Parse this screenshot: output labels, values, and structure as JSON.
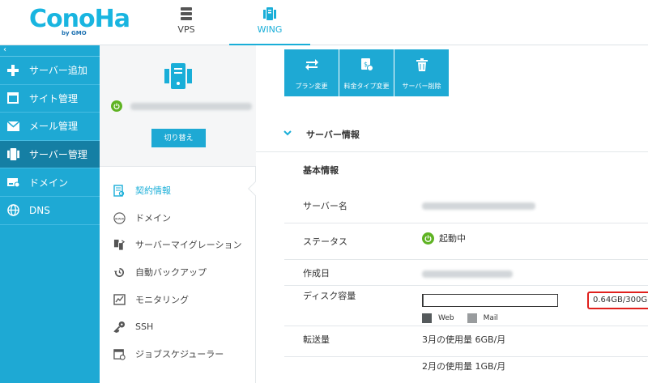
{
  "header": {
    "logo_main": "ConoHa",
    "logo_sub": "by GMO",
    "tabs": [
      {
        "label": "VPS",
        "icon": "server-stack-icon"
      },
      {
        "label": "WING",
        "icon": "wing-server-icon",
        "active": true
      }
    ]
  },
  "sidebar": {
    "collapse_glyph": "‹",
    "items": [
      {
        "label": "サーバー追加",
        "icon": "plus-icon"
      },
      {
        "label": "サイト管理",
        "icon": "window-icon"
      },
      {
        "label": "メール管理",
        "icon": "envelope-icon"
      },
      {
        "label": "サーバー管理",
        "icon": "server-icon",
        "active": true
      },
      {
        "label": "ドメイン",
        "icon": "domain-icon"
      },
      {
        "label": "DNS",
        "icon": "globe-icon"
      }
    ]
  },
  "server_panel": {
    "switch_label": "切り替え",
    "status_color": "#5fb323"
  },
  "menu": {
    "items": [
      {
        "label": "契約情報",
        "icon": "contract-icon",
        "active": true
      },
      {
        "label": "ドメイン",
        "icon": "www-icon"
      },
      {
        "label": "サーバーマイグレーション",
        "icon": "migration-icon"
      },
      {
        "label": "自動バックアップ",
        "icon": "backup-clock-icon"
      },
      {
        "label": "モニタリング",
        "icon": "monitor-chart-icon"
      },
      {
        "label": "SSH",
        "icon": "key-icon"
      },
      {
        "label": "ジョブスケジューラー",
        "icon": "calendar-icon"
      }
    ]
  },
  "actions": [
    {
      "label": "プラン変更",
      "icon": "swap-arrows-icon"
    },
    {
      "label": "料金タイプ変更",
      "icon": "price-doc-icon"
    },
    {
      "label": "サーバー削除",
      "icon": "trash-icon"
    }
  ],
  "server_info": {
    "section_title": "サーバー情報",
    "basic_title": "基本情報",
    "rows": {
      "name_label": "サーバー名",
      "status_label": "ステータス",
      "status_value": "起動中",
      "created_label": "作成日",
      "disk_label": "ディスク容量",
      "disk_value": "0.64GB/300GB",
      "disk_used_gb": 0.64,
      "disk_total_gb": 300,
      "legend_web": "Web",
      "legend_mail": "Mail",
      "transfer_label": "転送量",
      "transfer_month3": "3月の使用量 6GB/月",
      "transfer_month2": "2月の使用量 1GB/月"
    }
  },
  "colors": {
    "accent": "#1ea9d4",
    "sidebar_active": "#157fa4",
    "highlight_border": "#e0201c",
    "legend_web": "#555a5c",
    "legend_mail": "#999c9e"
  }
}
